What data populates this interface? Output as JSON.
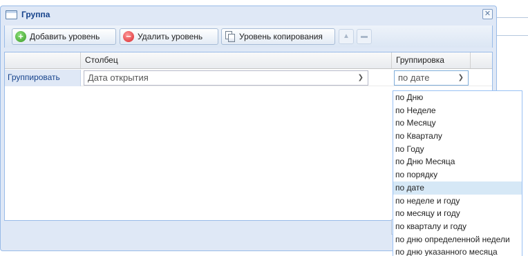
{
  "window": {
    "title": "Группа",
    "close_glyph": "✕"
  },
  "toolbar": {
    "add_level_label": "Добавить уровень",
    "delete_level_label": "Удалить уровень",
    "copy_level_label": "Уровень копирования",
    "move_up_glyph": "▲",
    "move_down_glyph": "▬"
  },
  "grid": {
    "columns": [
      "",
      "Столбец",
      "Группировка"
    ],
    "rows": [
      {
        "label": "Группировать",
        "column_value": "Дата открытия",
        "grouping_value": "по дате"
      }
    ]
  },
  "dropdown": {
    "options": [
      "по Дню",
      "по Неделе",
      "по Месяцу",
      "по Кварталу",
      "по Году",
      "по Дню Месяца",
      "по порядку",
      "по дате",
      "по неделе и году",
      "по месяцу и году",
      "по кварталу и году",
      "по дню определенной недели",
      "по дню указанного месяца"
    ],
    "selected": "по дате"
  },
  "icons": {
    "add": "add-circle-icon",
    "delete": "delete-circle-icon",
    "copy": "copy-document-icon",
    "combo_arrow": "chevron-down-icon"
  },
  "colors": {
    "dialog_bg": "#dfe8f6",
    "title_text": "#15428b",
    "selected_option": "#d6e8f6"
  }
}
